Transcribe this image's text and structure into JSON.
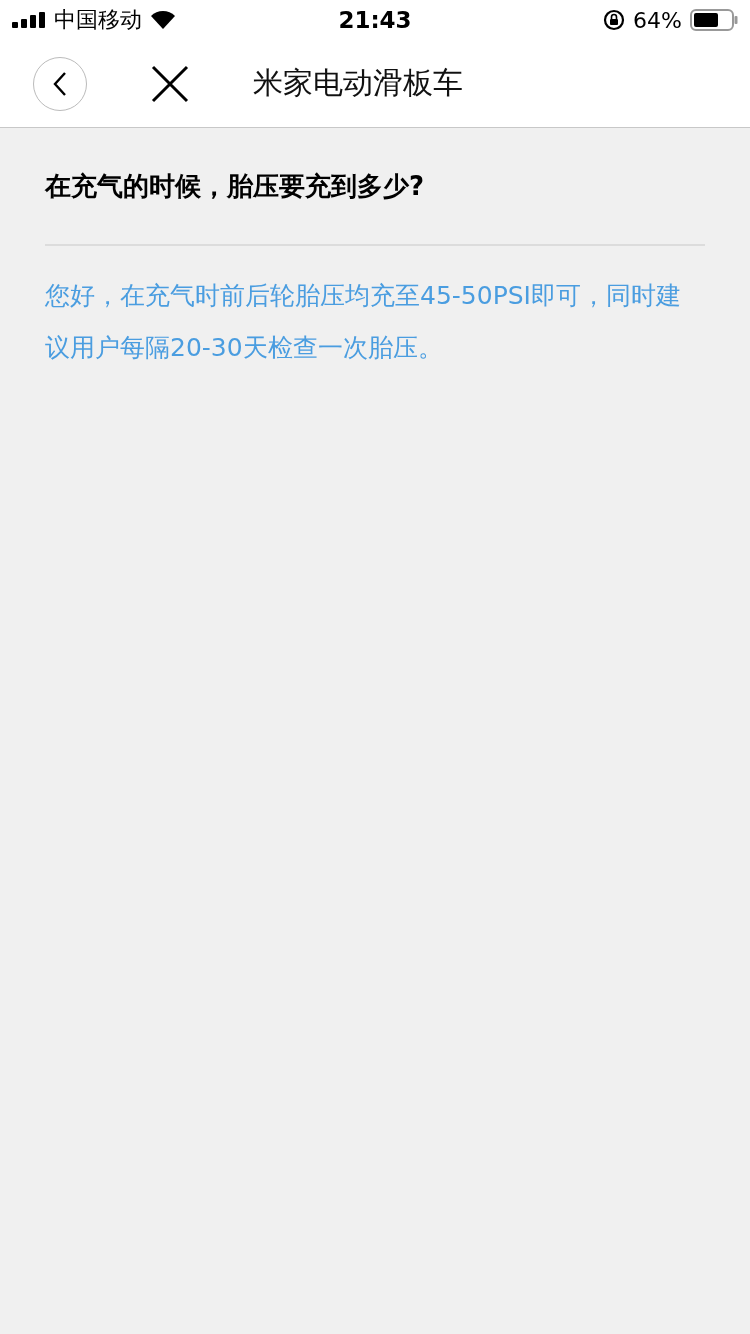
{
  "status_bar": {
    "carrier": "中国移动",
    "time": "21:43",
    "battery": "64%"
  },
  "nav": {
    "title": "米家电动滑板车"
  },
  "question": "在充气的时候，胎压要充到多少?",
  "answer": "您好，在充气时前后轮胎压均充至45-50PSI即可，同时建议用户每隔20-30天检查一次胎压。"
}
